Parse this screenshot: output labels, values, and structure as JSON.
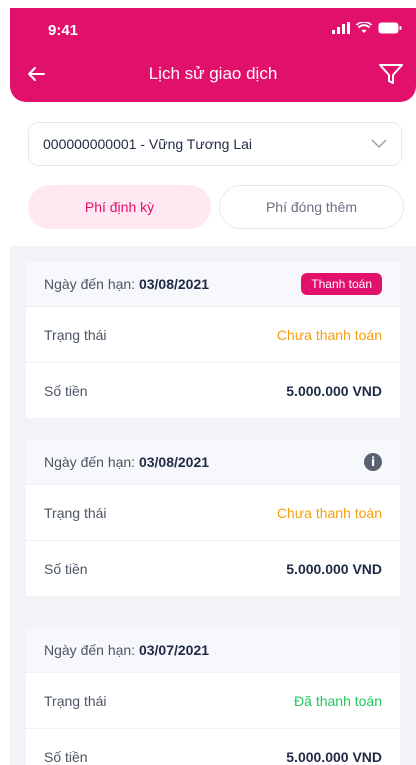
{
  "status_bar": {
    "time": "9:41"
  },
  "header": {
    "title": "Lịch sử giao dịch"
  },
  "account_selector": {
    "value": "000000000001 - Vững Tương Lai"
  },
  "tabs": [
    {
      "label": "Phí định kỳ",
      "active": true
    },
    {
      "label": "Phí đóng thêm",
      "active": false
    }
  ],
  "labels": {
    "due_date": "Ngày đến hạn:",
    "status": "Trạng thái",
    "amount": "Số tiền",
    "pay_button": "Thanh toán"
  },
  "records": [
    {
      "due_date": "03/08/2021",
      "status": "Chưa thanh toán",
      "amount": "5.000.000 VND",
      "action": "pay"
    },
    {
      "due_date": "03/08/2021",
      "status": "Chưa thanh toán",
      "amount": "5.000.000 VND",
      "action": "info"
    },
    {
      "due_date": "03/07/2021",
      "status": "Đã thanh toán",
      "amount": "5.000.000 VND",
      "action": "none"
    }
  ],
  "colors": {
    "brand": "#e1106b",
    "unpaid": "#f59e0b",
    "paid": "#22c55e"
  }
}
